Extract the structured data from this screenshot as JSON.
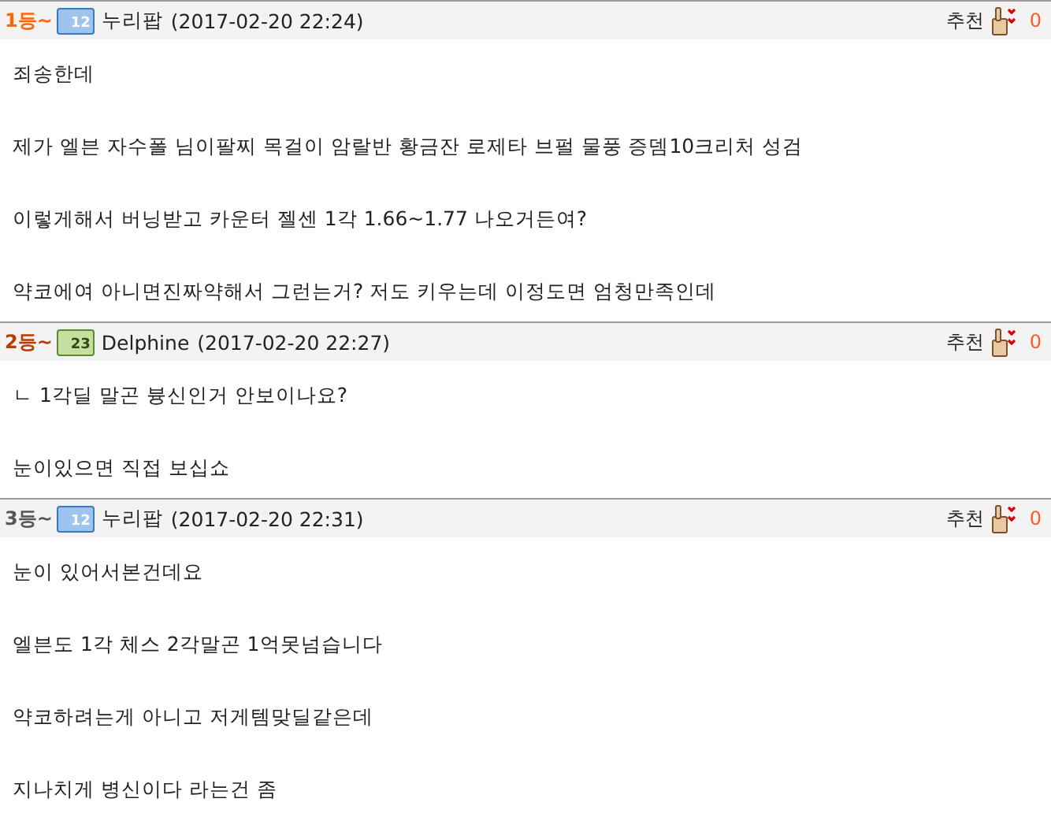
{
  "comments": [
    {
      "rank": "1등~",
      "color": "#ff6600",
      "level": "12",
      "kind": "blue",
      "author": "누리팝",
      "date": "(2017-02-20 22:24)",
      "recommend_label": "추천",
      "recommend_count": "0",
      "lines": [
        "죄송한데",
        "제가 엘븐 자수폴 님이팔찌 목걸이 암랄반 황금잔 로제타 브펄 물풍 증뎀10크리처 성검",
        "이렇게해서 버닝받고 카운터 젤센 1각 1.66~1.77 나오거든여?",
        "약코에여 아니면진짜약해서 그런는거? 저도 키우는데 이정도면 엄청만족인데"
      ]
    },
    {
      "rank": "2등~",
      "color": "#b83c00",
      "level": "23",
      "kind": "green",
      "author": "Delphine",
      "date": "(2017-02-20 22:27)",
      "recommend_label": "추천",
      "recommend_count": "0",
      "lines": [
        "ㄴ 1각딜 말곤 븅신인거 안보이나요?",
        "눈이있으면 직접 보십쇼"
      ]
    },
    {
      "rank": "3등~",
      "color": "#555555",
      "level": "12",
      "kind": "blue",
      "author": "누리팝",
      "date": "(2017-02-20 22:31)",
      "recommend_label": "추천",
      "recommend_count": "0",
      "lines": [
        "눈이 있어서본건데요",
        "엘븐도 1각 체스 2각말곤 1억못넘습니다",
        "약코하려는게 아니고 저게템맞딜같은데",
        "지나치게 병신이다 라는건 좀"
      ]
    }
  ]
}
